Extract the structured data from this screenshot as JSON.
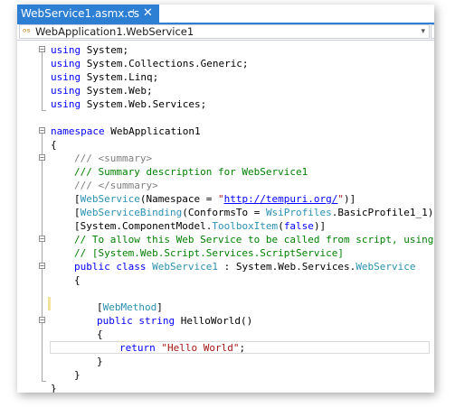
{
  "tab": {
    "title": "WebService1.asmx.cs",
    "pin_glyph": "⊣",
    "close_glyph": "✕"
  },
  "navigation": {
    "class_icon": "ᵒˢ",
    "selected_type": "WebApplication1.WebService1",
    "dropdown_glyph": "▾"
  },
  "code": {
    "l1": [
      "using",
      " System;"
    ],
    "l2": [
      "using",
      " System.Collections.Generic;"
    ],
    "l3": [
      "using",
      " System.Linq;"
    ],
    "l4": [
      "using",
      " System.Web;"
    ],
    "l5": [
      "using",
      " System.Web.Services;"
    ],
    "l7": [
      "namespace",
      " WebApplication1"
    ],
    "l8": "{",
    "l9": [
      "/// ",
      "<summary>"
    ],
    "l10": "/// Summary description for WebService1",
    "l11": [
      "/// ",
      "</summary>"
    ],
    "l12": [
      "[",
      "WebService",
      "(Namespace = ",
      "\"",
      "http://tempuri.org/",
      "\"",
      ")]"
    ],
    "l13": [
      "[",
      "WebServiceBinding",
      "(ConformsTo = ",
      "WsiProfiles",
      ".BasicProfile1_1)]"
    ],
    "l14": [
      "[System.ComponentModel.",
      "ToolboxItem",
      "(",
      "false",
      ")]"
    ],
    "l15": "// To allow this Web Service to be called from script, using AS",
    "l16": "// [System.Web.Script.Services.ScriptService]",
    "l17": [
      "public",
      " ",
      "class",
      " ",
      "WebService1",
      " : System.Web.Services.",
      "WebService"
    ],
    "l18": "{",
    "l20": [
      "[",
      "WebMethod",
      "]"
    ],
    "l21": [
      "public",
      " ",
      "string",
      " HelloWorld()"
    ],
    "l22": "{",
    "l23": [
      "return",
      " ",
      "\"Hello World\"",
      ";"
    ],
    "l24": "}",
    "l25": "}",
    "l26": "}"
  }
}
